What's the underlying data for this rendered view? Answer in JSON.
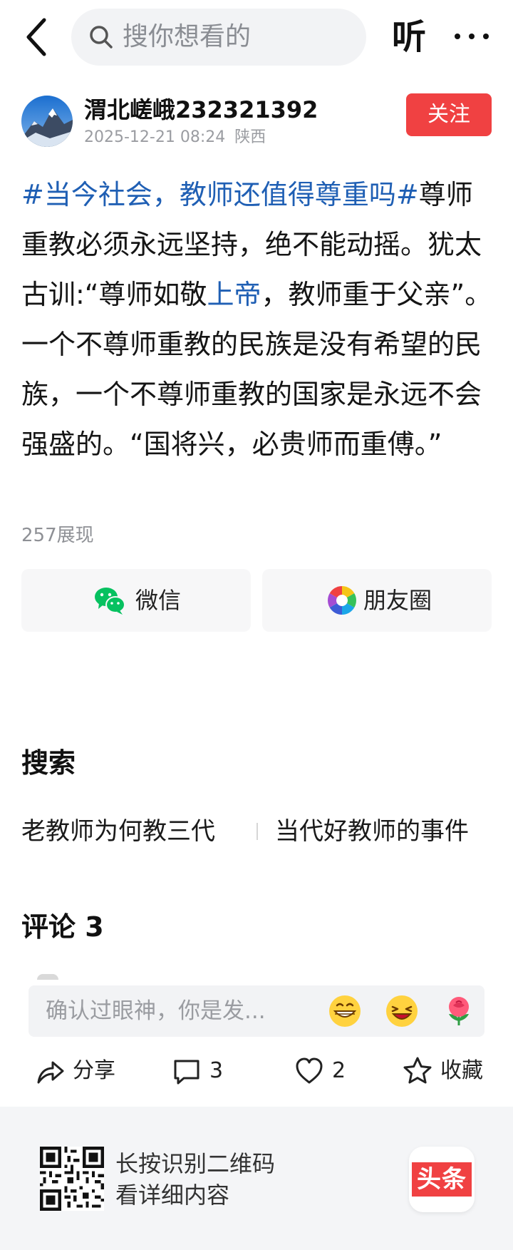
{
  "topbar": {
    "search_placeholder": "搜你想看的",
    "listen_label": "听"
  },
  "author": {
    "name": "渭北嵯峨232321392",
    "datetime": "2025-12-21 08:24",
    "location": "陕西",
    "follow_label": "关注"
  },
  "post": {
    "hashtag": "#当今社会，教师还值得尊重吗#",
    "text_1": "尊师重教必须永远坚持，绝不能动摇。犹太古训:“尊师如敬",
    "link": "上帝",
    "text_2": "，教师重于父亲”。一个不尊师重教的民族是没有希望的民族，一个不尊师重教的国家是永远不会强盛的。“国将兴，必贵师而重傅。”",
    "views": "257展现"
  },
  "share": {
    "wechat_label": "微信",
    "moments_label": "朋友圈"
  },
  "search_section": {
    "title": "搜索",
    "suggestions": [
      "老教师为何教三代",
      "当代好教师的事件"
    ]
  },
  "comments": {
    "title": "评论 3",
    "input_placeholder": "确认过眼神，你是发..."
  },
  "actions": {
    "share_label": "分享",
    "comment_count": "3",
    "like_count": "2",
    "favorite_label": "收藏"
  },
  "footer": {
    "line1": "长按识别二维码",
    "line2": "看详细内容",
    "logo_text": "头条"
  },
  "colors": {
    "accent_red": "#f04142",
    "link_blue": "#1f5fb4",
    "wechat_green": "#07c160"
  }
}
